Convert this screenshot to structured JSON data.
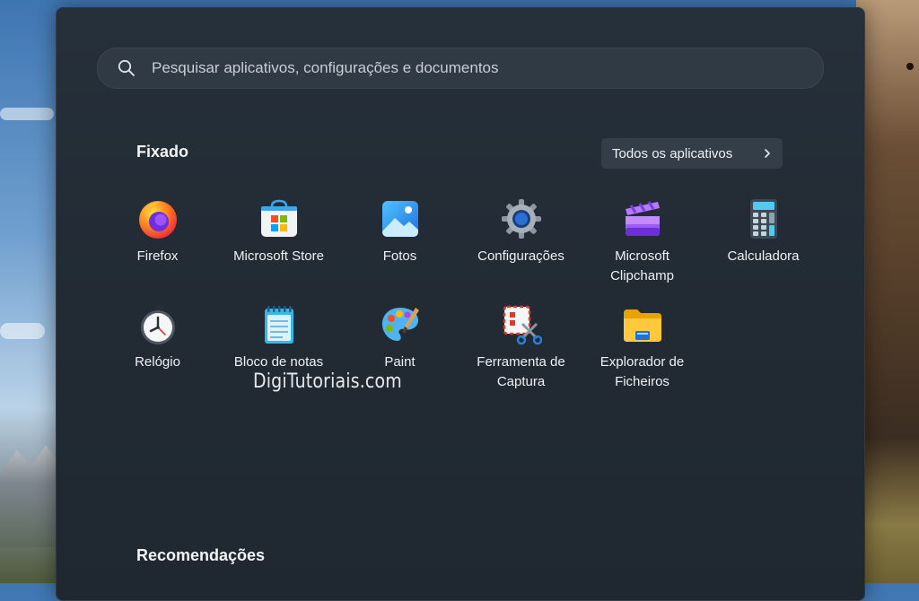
{
  "search": {
    "placeholder": "Pesquisar aplicativos, configurações e documentos",
    "icon": "search-icon"
  },
  "pinned": {
    "title": "Fixado",
    "all_apps_label": "Todos os aplicativos",
    "apps": [
      {
        "label": "Firefox",
        "icon": "firefox-icon"
      },
      {
        "label": "Microsoft Store",
        "icon": "microsoft-store-icon"
      },
      {
        "label": "Fotos",
        "icon": "photos-icon"
      },
      {
        "label": "Configurações",
        "icon": "settings-gear-icon"
      },
      {
        "label": "Microsoft Clipchamp",
        "icon": "clipchamp-icon"
      },
      {
        "label": "Calculadora",
        "icon": "calculator-icon"
      },
      {
        "label": "Relógio",
        "icon": "clock-icon"
      },
      {
        "label": "Bloco de notas",
        "icon": "notepad-icon"
      },
      {
        "label": "Paint",
        "icon": "paint-palette-icon"
      },
      {
        "label": "Ferramenta de Captura",
        "icon": "snipping-tool-icon"
      },
      {
        "label": "Explorador de Ficheiros",
        "icon": "file-explorer-folder-icon"
      }
    ]
  },
  "recommendations": {
    "title": "Recomendações"
  },
  "watermark": "DigiTutoriais.com",
  "colors": {
    "menu_background": "#222b34",
    "search_background": "#2f3a45",
    "button_background": "#333e49",
    "text": "#eef1f4"
  }
}
